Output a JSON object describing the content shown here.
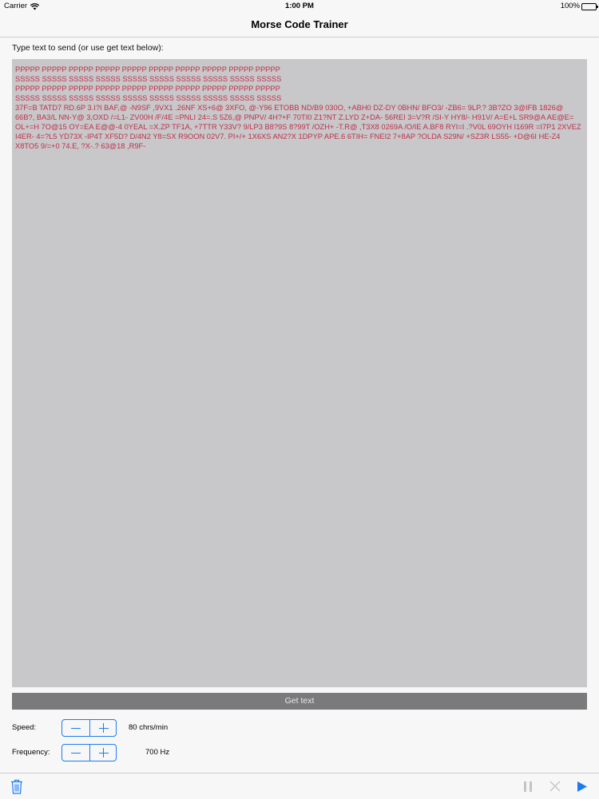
{
  "status_bar": {
    "carrier": "Carrier",
    "time": "1:00 PM",
    "battery": "100%"
  },
  "nav": {
    "title": "Morse Code Trainer"
  },
  "prompt": "Type text to send (or use get text below):",
  "text_area": {
    "value": "PPPPP PPPPP PPPPP PPPPP PPPPP PPPPP PPPPP PPPPP PPPPP PPPPP\nSSSSS SSSSS SSSSS SSSSS SSSSS SSSSS SSSSS SSSSS SSSSS SSSSS\nPPPPP PPPPP PPPPP PPPPP PPPPP PPPPP PPPPP PPPPP PPPPP PPPPP\nSSSSS SSSSS SSSSS SSSSS SSSSS SSSSS SSSSS SSSSS SSSSS SSSSS\n37F=B TATD7 RD.6P 3.I?I BAF,@ -N9SF ,9VX1 .26NF XS+6@ 3XFO, @-Y96 ETOBB ND/B9 030O, +ABH0 DZ-DY 0BHN/ BFO3/ -ZB6= 9LP.? 3B?ZO 3@IFB 1826@ 66B?, BA3/L NN-Y@ 3,OXD /=L1- ZV00H /F/4E =PNLI 24=.S 5Z6,@ PNPV/ 4H?+F 70TI0 Z1?NT Z.LYD Z+DA- 56REI 3=V?R /SI-Y HY8/- H91V/ A=E+L SR9@A AE@E= OL+=H 7O@15 OY=EA E@@-4 0YEAL =X.ZP TF1A, +7TTR Y33V? 9/LP3 B8?9S 8?99T /OZH+ -T.R@ ,T3X8 0269A /O/IE A.BF8 RYI=I .?V0L 69OYH I169R =I7P1 2XVEZ I4ER- 4=?L5 YD73X -IP4T XF5D? D/4N2 Y8=SX R9OON 02V7. PI+/+ 1X6XS AN2?X 1DPYP APE.6 6TIH= FNEI2 7+8AP ?OLDA S29N/ +SZ3R LS55- +D@6I HE-Z4 X8TO5 9/=+0 74.E, ?X-.? 63@18 ,R9F-"
  },
  "get_text_label": "Get text",
  "speed": {
    "label": "Speed:",
    "value": "80 chrs/min"
  },
  "frequency": {
    "label": "Frequency:",
    "value": "700 Hz"
  },
  "colors": {
    "accent": "#1b7cf2",
    "text_red": "#c0304a",
    "text_area_bg": "#c8c7c9",
    "button_bg": "#7a7a7c"
  },
  "toolbar": {
    "icons": [
      "trash-icon",
      "pause-icon",
      "stop-icon",
      "play-icon"
    ]
  }
}
